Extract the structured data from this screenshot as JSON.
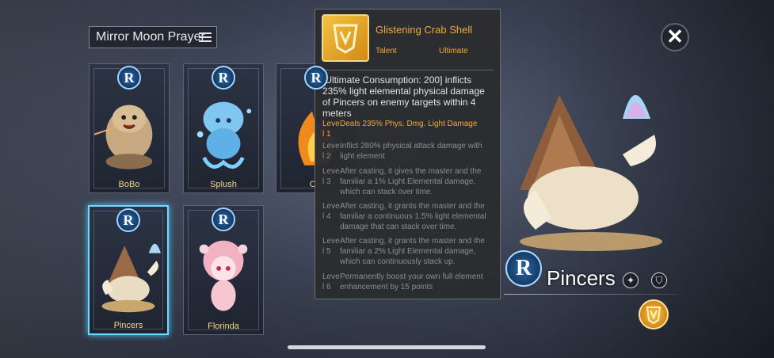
{
  "header": {
    "title": "Mirror Moon Prayer"
  },
  "cards": [
    {
      "name": "BoBo",
      "rank": "R"
    },
    {
      "name": "Splush",
      "rank": "R"
    },
    {
      "name": "Cin",
      "rank": "R"
    },
    {
      "name": "Pincers",
      "rank": "R",
      "selected": true
    },
    {
      "name": "Florinda",
      "rank": "R"
    }
  ],
  "tooltip": {
    "skill_name": "Glistening Crab Shell",
    "type": "Talent",
    "subtype": "Ultimate",
    "description": "[Ultimate Consumption: 200] inflicts 235% light elemental physical damage of Pincers on enemy targets within 4 meters",
    "levels": [
      {
        "label": "Leve l 1",
        "text": "Deals 235% Phys. Dmg. Light Damage"
      },
      {
        "label": "Leve l 2",
        "text": "Inflict 280% physical attack damage with light element"
      },
      {
        "label": "Leve l 3",
        "text": "After casting, it gives the master and the familiar a 1% Light Elemental damage, which can stack over time."
      },
      {
        "label": "Leve l 4",
        "text": "After casting, it grants the master and the familiar a continuous 1.5% light elemental damage that can stack over time."
      },
      {
        "label": "Leve l 5",
        "text": "After casting, it grants the master and the familiar a 2% Light Elemental damage, which can continuously stack up."
      },
      {
        "label": "Leve l 6",
        "text": "Permanently boost your own full element enhancement by 15 points"
      }
    ]
  },
  "detail": {
    "name": "Pincers",
    "rank": "R",
    "close_symbol": "✕"
  },
  "colors": {
    "accent": "#f1a73b",
    "rank_blue": "#1f5a96",
    "selected_border": "#6fd8ff"
  }
}
